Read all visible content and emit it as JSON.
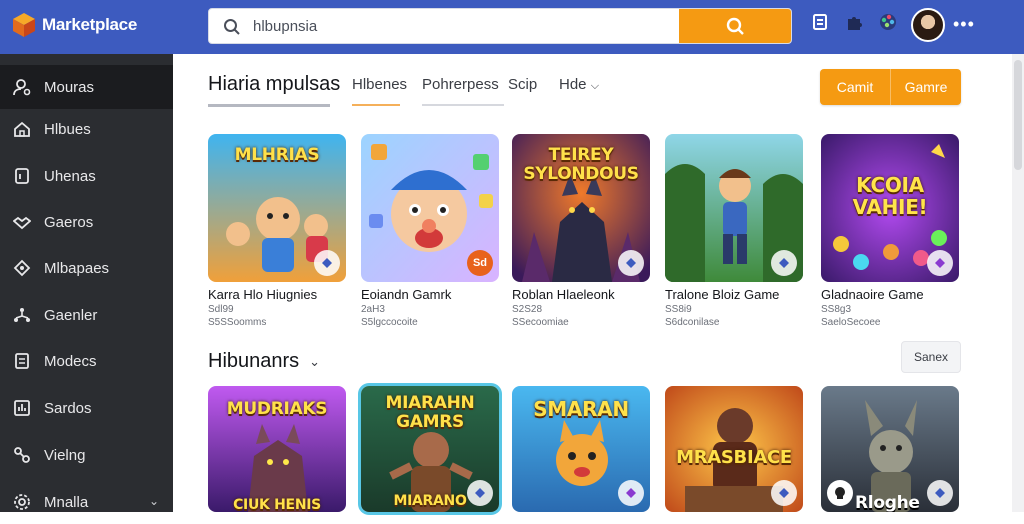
{
  "app": {
    "name": "Marketplace"
  },
  "search": {
    "value": "hlbupnsia"
  },
  "sidebar": {
    "items": [
      {
        "label": "Mouras",
        "icon": "user-gear-icon"
      },
      {
        "label": "Hlbues",
        "icon": "home-icon"
      },
      {
        "label": "Uhenas",
        "icon": "square-icon"
      },
      {
        "label": "Gaeros",
        "icon": "handshake-icon"
      },
      {
        "label": "Mlbapaes",
        "icon": "tag-icon"
      },
      {
        "label": "Gaenler",
        "icon": "network-icon"
      },
      {
        "label": "Modecs",
        "icon": "list-icon"
      },
      {
        "label": "Sardos",
        "icon": "chart-icon"
      },
      {
        "label": "Vielng",
        "icon": "tools-icon"
      },
      {
        "label": "Mnalla",
        "icon": "gear-icon"
      }
    ]
  },
  "tabs": [
    {
      "label": "Hiaria mpulsas"
    },
    {
      "label": "Hlbenes"
    },
    {
      "label": "Pohrerpess"
    },
    {
      "label": "Scip"
    },
    {
      "label": "Hde"
    }
  ],
  "header_buttons": {
    "left": "Camit",
    "right": "Gamre"
  },
  "section1": {
    "cards": [
      {
        "title": "MLHRIAS",
        "name": "Karra Hlo Hiugnies",
        "meta1": "Sdl99",
        "meta2": "S5SSoomms"
      },
      {
        "title": "",
        "name": "Eoiandn Gamrk",
        "meta1": "2aH3",
        "meta2": "S5lgccocoite",
        "badge": "Sd"
      },
      {
        "title": "TEIREY SYLONDOUS",
        "name": "Roblan Hlaeleonk",
        "meta1": "S2S28",
        "meta2": "SSecoomiae"
      },
      {
        "title": "",
        "name": "Tralone Bloiz Game",
        "meta1": "SS8i9",
        "meta2": "S6dconilase"
      },
      {
        "title": "KCOIA VAHIE!",
        "name": "Gladnaoire Game",
        "meta1": "SS8g3",
        "meta2": "SaeloSecoee"
      }
    ]
  },
  "section2": {
    "title": "Hibunanrs",
    "see_more": "Sanex",
    "cards": [
      {
        "title": "MUDRIAKS",
        "bottom": "CIUK HENIS"
      },
      {
        "title": "MIARAHN GAMRS",
        "bottom": "MIARANO"
      },
      {
        "title": "SMARAN",
        "bottom": ""
      },
      {
        "title": "MRASBIACE",
        "bottom": ""
      },
      {
        "title": "",
        "bottom": "Rloghe"
      }
    ]
  },
  "colors": {
    "topbar": "#3d5bbf",
    "sidebar": "#2b2d31",
    "accent": "#f59a12"
  }
}
